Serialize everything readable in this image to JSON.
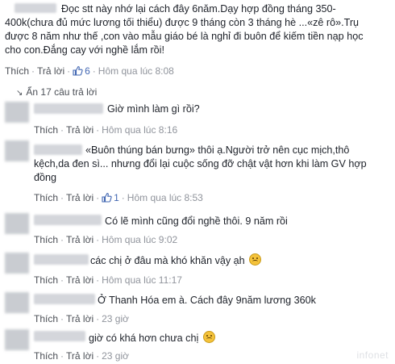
{
  "post": {
    "text": "Đọc stt này nhớ lại cách đây 6năm.Dạy hợp đồng tháng 350-400k(chưa đủ mức lương tối thiểu) được 9 tháng còn 3 tháng hè ...«zê rô».Trụ được 8 năm như thế ,con vào mẫu giáo bé là nghỉ đi buôn để kiếm tiền nạp học cho con.Đắng cay với nghề lắm rồi!",
    "like_label": "Thích",
    "reply_label": "Trả lời",
    "like_count": "6",
    "time": "Hôm qua lúc 8:08"
  },
  "collapse": {
    "label": "Ẩn 17 câu trả lời"
  },
  "replies": [
    {
      "text": "Giờ mình làm gì rồi?",
      "like": "Thích",
      "reply": "Trả lời",
      "time": "Hôm qua lúc 8:16"
    },
    {
      "text": "«Buôn thúng bán bưng» thôi ạ.Người trở nên cục mịch,thô kệch,da đen sì... nhưng đổi lại cuộc sống đỡ chật vật hơn khi làm GV hợp đồng",
      "like": "Thích",
      "reply": "Trả lời",
      "like_count": "1",
      "time": "Hôm qua lúc 8:53"
    },
    {
      "text": "Có lẽ mình cũng đổi nghề thôi. 9 năm rồi",
      "like": "Thích",
      "reply": "Trả lời",
      "time": "Hôm qua lúc 9:02"
    },
    {
      "text": "các chị ở đâu mà khó khăn vậy ạh",
      "like": "Thích",
      "reply": "Trả lời",
      "time": "Hôm qua lúc 11:17"
    },
    {
      "text": "Ở Thanh Hóa em à. Cách đây 9năm lương 360k",
      "like": "Thích",
      "reply": "Trả lời",
      "time": "23 giờ"
    },
    {
      "text": "giờ có khá hơn chưa chị",
      "like": "Thích",
      "reply": "Trả lời",
      "time": "23 giờ"
    }
  ],
  "icons": {
    "like": "thumbs-up-icon",
    "emoji": "frowning-face-icon"
  },
  "colors": {
    "link": "#4b4f56",
    "like_blue": "#4267b2",
    "meta": "#90949c"
  }
}
